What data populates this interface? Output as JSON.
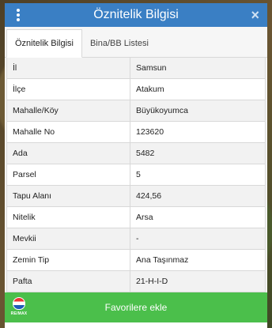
{
  "header": {
    "title": "Öznitelik Bilgisi",
    "close_label": "×"
  },
  "tabs": [
    {
      "label": "Öznitelik Bilgisi",
      "active": true
    },
    {
      "label": "Bina/BB Listesi",
      "active": false
    }
  ],
  "attributes": [
    {
      "key": "İl",
      "value": "Samsun"
    },
    {
      "key": "İlçe",
      "value": "Atakum"
    },
    {
      "key": "Mahalle/Köy",
      "value": "Büyükoyumca"
    },
    {
      "key": "Mahalle No",
      "value": "123620"
    },
    {
      "key": "Ada",
      "value": "5482"
    },
    {
      "key": "Parsel",
      "value": "5"
    },
    {
      "key": "Tapu Alanı",
      "value": "424,56"
    },
    {
      "key": "Nitelik",
      "value": "Arsa"
    },
    {
      "key": "Mevkii",
      "value": "-"
    },
    {
      "key": "Zemin Tip",
      "value": "Ana Taşınmaz"
    },
    {
      "key": "Pafta",
      "value": "21-H-I-D"
    }
  ],
  "footer": {
    "favorite_label": "Favorilere ekle",
    "logo_text": "RE/MAX"
  },
  "colors": {
    "header_bg": "#3a7fc4",
    "favorite_bg": "#4bbf4b"
  },
  "icons": {
    "menu": "kebab-menu-icon",
    "close": "close-icon",
    "logo": "remax-balloon-logo"
  }
}
